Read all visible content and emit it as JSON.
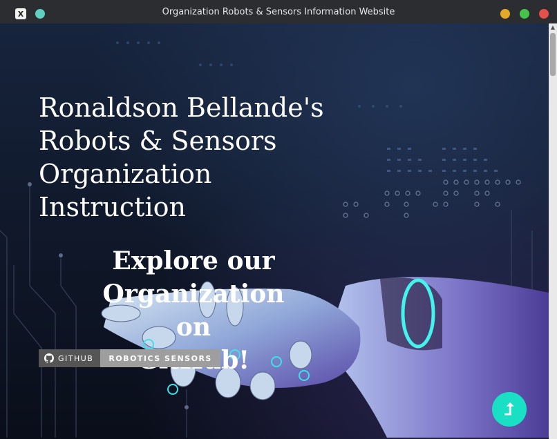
{
  "window": {
    "title": "Organization Robots & Sensors Information Website",
    "app_icon": "x-app-icon"
  },
  "hero": {
    "title_lines": [
      "Ronaldson Bellande's",
      "Robots & Sensors",
      "Organization",
      "Instruction"
    ]
  },
  "explore": {
    "lines": [
      "Explore our",
      "Organization on",
      "GitHub!"
    ]
  },
  "badge": {
    "left_label": "GITHUB",
    "right_label": "ROBOTICS SENSORS",
    "icon": "github-icon"
  },
  "back_to_top": {
    "icon": "arrow-up-icon",
    "glyph": "⮥"
  },
  "colors": {
    "accent": "#19e0c4",
    "badge_left": "#555555",
    "badge_right": "#9e9e9e"
  }
}
